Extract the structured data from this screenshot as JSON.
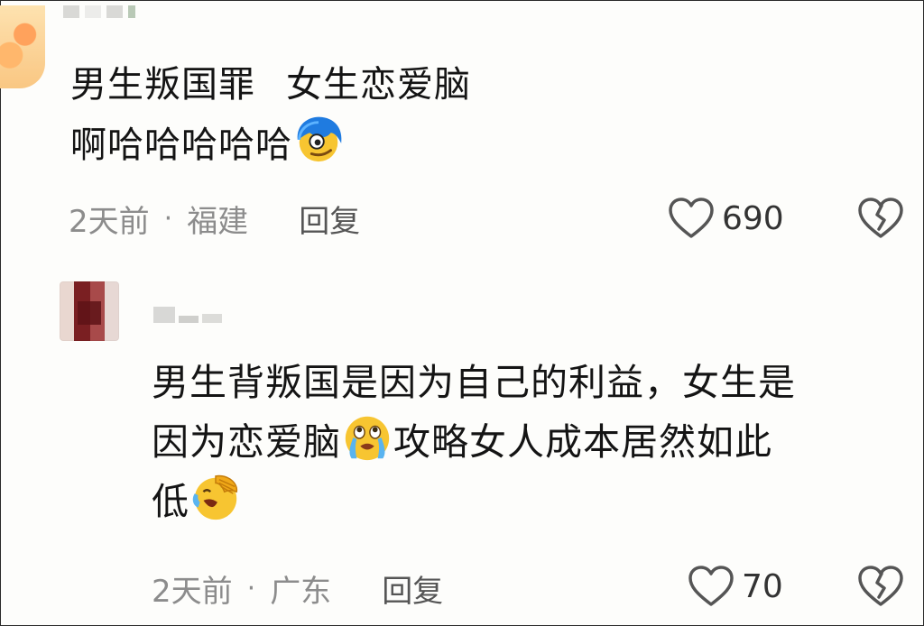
{
  "comments": [
    {
      "line1_a": "男生叛国罪",
      "line1_b": "女生恋爱脑",
      "line2": "啊哈哈哈哈哈",
      "line2_emoji": "smirking-blue-hair-emoji",
      "meta": {
        "time": "2天前",
        "separator": "·",
        "location": "福建",
        "reply": "回复"
      },
      "likes": "690"
    },
    {
      "line1": "男生背叛国是因为自己的利益，女生是",
      "line2_a": "因为恋爱脑",
      "line2_emoji": "crying-face-emoji",
      "line2_b": "攻略女人成本居然如此",
      "line3": "低",
      "line3_emoji": "laughing-facepalm-emoji",
      "meta": {
        "time": "2天前",
        "separator": "·",
        "location": "广东",
        "reply": "回复"
      },
      "likes": "70"
    }
  ],
  "icons": {
    "like": "heart-outline-icon",
    "dislike": "broken-heart-icon"
  },
  "colors": {
    "text": "#141414",
    "meta": "#8c8c8c",
    "icon": "#555555",
    "background": "#fdfdfb"
  }
}
